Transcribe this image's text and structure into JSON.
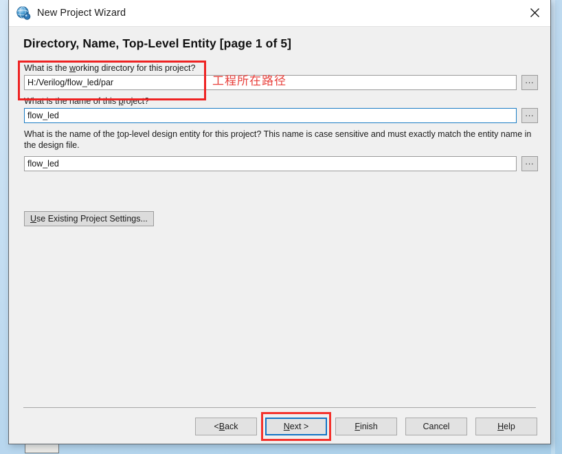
{
  "window": {
    "title": "New Project Wizard",
    "icon": "quartus-globe-icon",
    "close_icon": "close-icon"
  },
  "page": {
    "heading": "Directory, Name, Top-Level Entity [page 1 of 5]"
  },
  "fields": [
    {
      "name": "working-directory",
      "label_pre": "What is the ",
      "label_mnemonic": "w",
      "label_post": "orking directory for this project?",
      "label_full": "What is the working directory for this project?",
      "value": "H:/Verilog/flow_led/par",
      "browse_label": "...",
      "focused": false
    },
    {
      "name": "project-name",
      "label_pre": "What is the name of this ",
      "label_mnemonic": "p",
      "label_post": "roject?",
      "label_full": "What is the name of this project?",
      "value": "flow_led",
      "browse_label": "...",
      "focused": true
    },
    {
      "name": "top-level-entity",
      "label_pre": "What is the name of the ",
      "label_mnemonic": "t",
      "label_post": "op-level design entity for this project? This name is case sensitive and must exactly match the entity name in the design file.",
      "label_full": "What is the name of the top-level design entity for this project? This name is case sensitive and must exactly match the entity name in the design file.",
      "value": "flow_led",
      "browse_label": "...",
      "focused": false
    }
  ],
  "use_existing": {
    "label_pre": "",
    "label_mnemonic": "U",
    "label_post": "se Existing Project Settings...",
    "label_full": "Use Existing Project Settings..."
  },
  "annotations": [
    {
      "name": "working-directory-annotation",
      "text": "工程所在路径",
      "color": "#e8413c"
    },
    {
      "name": "next-button-annotation",
      "text": "",
      "color": "#f4312b"
    }
  ],
  "buttons": [
    {
      "name": "back-button",
      "pre": "< ",
      "mnemonic": "B",
      "post": "ack",
      "full": "< Back",
      "default": false
    },
    {
      "name": "next-button",
      "pre": "",
      "mnemonic": "N",
      "post": "ext >",
      "full": "Next >",
      "default": true
    },
    {
      "name": "finish-button",
      "pre": "",
      "mnemonic": "F",
      "post": "inish",
      "full": "Finish",
      "default": false
    },
    {
      "name": "cancel-button",
      "pre": "Cancel",
      "mnemonic": "",
      "post": "",
      "full": "Cancel",
      "default": false
    },
    {
      "name": "help-button",
      "pre": "",
      "mnemonic": "H",
      "post": "elp",
      "full": "Help",
      "default": false
    }
  ],
  "colors": {
    "accent": "#1273c4",
    "annotation_red": "#ee2222",
    "dialog_bg": "#f0f0f0",
    "titlebar_bg": "#ffffff",
    "desktop_bg": "#bcd9ef"
  }
}
